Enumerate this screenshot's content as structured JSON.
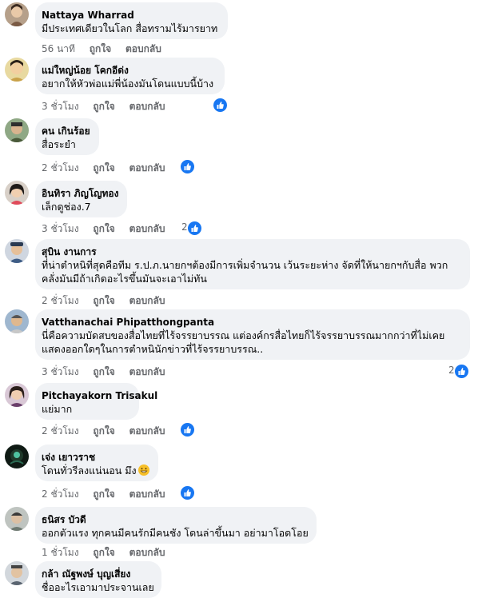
{
  "actions": {
    "like": "ถูกใจ",
    "reply": "ตอบกลับ"
  },
  "comments": [
    {
      "author": "Nattaya Wharrad",
      "lines": [
        "มีประเทศเดียวในโลก สื่อทรามไร้มารยาท"
      ],
      "time": "56 นาที",
      "reactions": ""
    },
    {
      "author": "แม่ใหญ่น้อย โคกอีด่ง",
      "lines": [
        "อยากให้หัวพ่อแม่พี่น้องมันโดนแบบนี้บ้าง"
      ],
      "time": "3 ชั่วโมง",
      "reactions": ""
    },
    {
      "author": "คน เกินร้อย",
      "lines": [
        "สื่อระยำ"
      ],
      "time": "2 ชั่วโมง",
      "reactions": ""
    },
    {
      "author": "อินทิรา ภิญโญทอง",
      "lines": [
        "เล็กดูช่อง.7"
      ],
      "time": "3 ชั่วโมง",
      "reactions": "2"
    },
    {
      "author": "สุบิน งานการ",
      "lines": [
        "ที่น่าตำหนิที่สุดคือทีม ร.ป.ภ.นายกฯต้องมีการเพิ่มจำนวน เว้นระยะห่าง จัดที่ให้นายกฯกับสื่อ พวก",
        "คลั่งมันมีถ้าเกิดอะไรขึ้นมันจะเอาไม่ทัน"
      ],
      "time": "2 ชั่วโมง",
      "reactions": ""
    },
    {
      "author": "Vatthanachai Phipatthongpanta",
      "lines": [
        "นี่คือความบัดสบของสื่อไทยที่ไร้จรรยาบรรณ แต่องค์กรสื่อไทยก็ไร้จรรยาบรรณมากกว่าที่ไม่เคย",
        "แสดงออกใดๆในการตำหนินักข่าวที่ไร้จรรยาบรรณ.."
      ],
      "time": "3 ชั่วโมง",
      "reactions": "2"
    },
    {
      "author": "Pitchayakorn Trisakul",
      "lines": [
        "แย่มาก"
      ],
      "time": "2 ชั่วโมง",
      "reactions": ""
    },
    {
      "author": "เจ่ง เยาวราช",
      "lines": [
        "โดนทั่วรีลงแน่นอน มึง"
      ],
      "time": "2 ชั่วโมง",
      "reactions": ""
    },
    {
      "author": "ธนิสร บัวดี",
      "lines": [
        "ออกตัวแรง ทุกคนมีคนรักมีคนชัง โดนล่าขึ้นมา อย่ามาโอดโอย"
      ],
      "time": "1 ชั่วโมง",
      "reactions": ""
    },
    {
      "author": "กล้า ณัฐพงษ์ บุญเสี่ยง",
      "lines": [
        "ชื่ออะไรเอามาประจานเลย"
      ],
      "time": "",
      "reactions": ""
    }
  ]
}
